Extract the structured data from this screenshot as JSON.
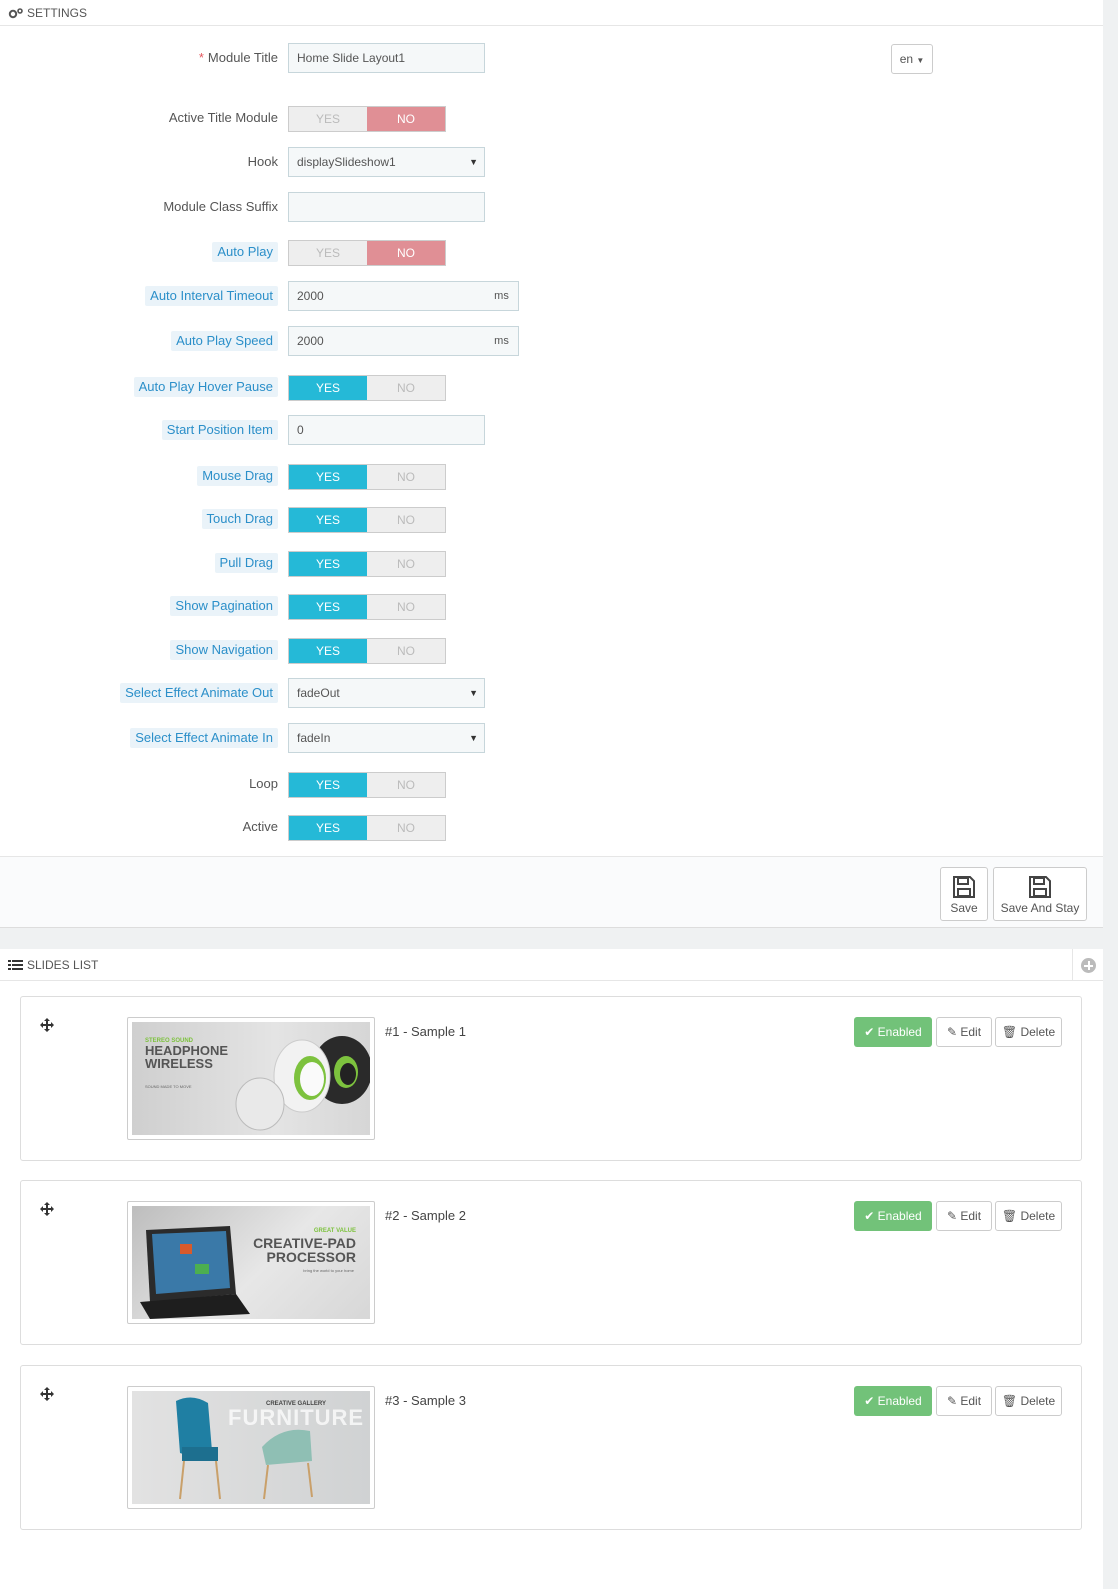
{
  "settings": {
    "heading": "SETTINGS",
    "lang_button": "en",
    "fields": {
      "module_title": {
        "label": "Module Title",
        "required": "*",
        "value": "Home Slide Layout1"
      },
      "active_title_module": {
        "label": "Active Title Module",
        "yes": "YES",
        "no": "NO",
        "selected": "NO"
      },
      "hook": {
        "label": "Hook",
        "value": "displaySlideshow1"
      },
      "module_class_suffix": {
        "label": "Module Class Suffix",
        "value": ""
      },
      "auto_play": {
        "label": "Auto Play",
        "yes": "YES",
        "no": "NO",
        "selected": "NO"
      },
      "auto_interval_timeout": {
        "label": "Auto Interval Timeout",
        "value": "2000",
        "unit": "ms"
      },
      "auto_play_speed": {
        "label": "Auto Play Speed",
        "value": "2000",
        "unit": "ms"
      },
      "auto_play_hover_pause": {
        "label": "Auto Play Hover Pause",
        "yes": "YES",
        "no": "NO",
        "selected": "YES"
      },
      "start_position_item": {
        "label": "Start Position Item",
        "value": "0"
      },
      "mouse_drag": {
        "label": "Mouse Drag",
        "yes": "YES",
        "no": "NO",
        "selected": "YES"
      },
      "touch_drag": {
        "label": "Touch Drag",
        "yes": "YES",
        "no": "NO",
        "selected": "YES"
      },
      "pull_drag": {
        "label": "Pull Drag",
        "yes": "YES",
        "no": "NO",
        "selected": "YES"
      },
      "show_pagination": {
        "label": "Show Pagination",
        "yes": "YES",
        "no": "NO",
        "selected": "YES"
      },
      "show_navigation": {
        "label": "Show Navigation",
        "yes": "YES",
        "no": "NO",
        "selected": "YES"
      },
      "select_effect_animate_out": {
        "label": "Select Effect Animate Out",
        "value": "fadeOut"
      },
      "select_effect_animate_in": {
        "label": "Select Effect Animate In",
        "value": "fadeIn"
      },
      "loop": {
        "label": "Loop",
        "yes": "YES",
        "no": "NO",
        "selected": "YES"
      },
      "active": {
        "label": "Active",
        "yes": "YES",
        "no": "NO",
        "selected": "YES"
      }
    },
    "footer": {
      "save": "Save",
      "save_and_stay": "Save And Stay"
    }
  },
  "slides_list": {
    "heading": "SLIDES LIST",
    "actions": {
      "enabled": "Enabled",
      "edit": "Edit",
      "delete": "Delete"
    },
    "items": [
      {
        "title": "#1 - Sample 1",
        "thumb_line1": "STEREO SOUND",
        "thumb_line2": "HEADPHONE",
        "thumb_line3": "WIRELESS",
        "thumb_line4": "SOUND MADE TO MOVE"
      },
      {
        "title": "#2 - Sample 2",
        "thumb_line1": "GREAT VALUE",
        "thumb_line2": "CREATIVE-PAD",
        "thumb_line3": "PROCESSOR",
        "thumb_line4": "bring the world to your home"
      },
      {
        "title": "#3 - Sample 3",
        "thumb_line1": "CREATIVE GALLERY",
        "thumb_line2": "FURNITURE"
      }
    ]
  },
  "colors": {
    "accent": "#25b9d7",
    "no_active": "#e08f95",
    "enabled": "#72c279",
    "hint_label": "#2b8fc9"
  }
}
